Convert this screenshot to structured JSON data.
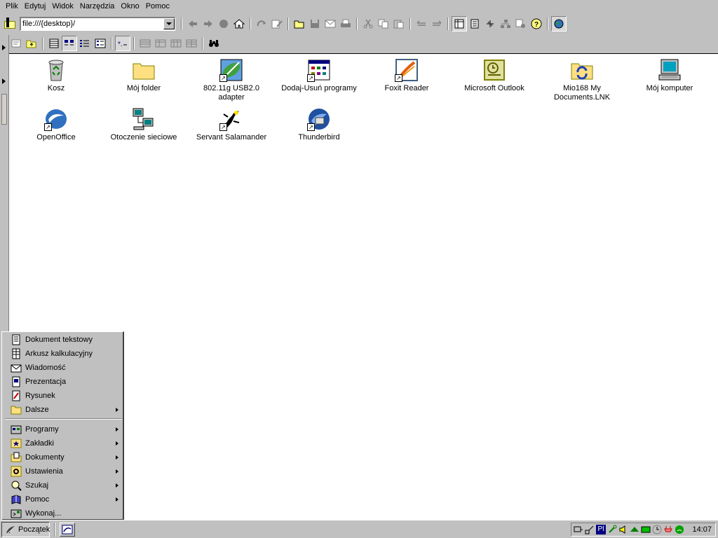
{
  "menubar": {
    "items": [
      {
        "label": "Plik"
      },
      {
        "label": "Edytuj"
      },
      {
        "label": "Widok"
      },
      {
        "label": "Narzędzia"
      },
      {
        "label": "Okno"
      },
      {
        "label": "Pomoc"
      }
    ]
  },
  "address": {
    "value": "file:///{desktop}/"
  },
  "toolbar1": {
    "icons": [
      "back-arrow-icon",
      "forward-arrow-icon",
      "stop-icon",
      "home-icon",
      "reload-icon",
      "edit-icon",
      "open-icon",
      "save-icon",
      "mail-icon",
      "print-icon",
      "cut-icon",
      "copy-icon",
      "paste-icon",
      "undo-icon",
      "redo-icon",
      "panel-icon",
      "bookmark-icon",
      "tools-icon",
      "hierarchy-icon",
      "settings-icon",
      "help-icon",
      "globe-icon"
    ]
  },
  "toolbar2": {
    "icons": [
      "properties-icon",
      "up-folder-icon",
      "details-view-icon",
      "icons-view-icon",
      "list-view-icon",
      "tree-view-icon",
      "filter-icon",
      "cols-icon",
      "cols2-icon",
      "cols3-icon",
      "cols4-icon",
      "binoculars-icon"
    ]
  },
  "desktop": {
    "icons": [
      {
        "label": "Kosz",
        "icon": "recycle-bin-icon",
        "shortcut": false
      },
      {
        "label": "Mój folder",
        "icon": "folder-icon",
        "shortcut": false
      },
      {
        "label": "802.11g USB2.0 adapter",
        "icon": "network-adapter-icon",
        "shortcut": true
      },
      {
        "label": "Dodaj-Usuń programy",
        "icon": "add-remove-programs-icon",
        "shortcut": true
      },
      {
        "label": "Foxit Reader",
        "icon": "foxit-icon",
        "shortcut": true
      },
      {
        "label": "Microsoft Outlook",
        "icon": "outlook-icon",
        "shortcut": false
      },
      {
        "label": "Mio168 My Documents.LNK",
        "icon": "sync-folder-icon",
        "shortcut": false
      },
      {
        "label": "Mój komputer",
        "icon": "computer-icon",
        "shortcut": false
      },
      {
        "label": "OpenOffice",
        "icon": "openoffice-icon",
        "shortcut": true
      },
      {
        "label": "Otoczenie sieciowe",
        "icon": "network-neighborhood-icon",
        "shortcut": false
      },
      {
        "label": "Servant Salamander",
        "icon": "salamander-icon",
        "shortcut": true
      },
      {
        "label": "Thunderbird",
        "icon": "thunderbird-icon",
        "shortcut": true
      }
    ]
  },
  "startmenu": {
    "items_top": [
      {
        "label": "Dokument tekstowy",
        "submenu": false
      },
      {
        "label": "Arkusz kalkulacyjny",
        "submenu": false
      },
      {
        "label": "Wiadomość",
        "submenu": false
      },
      {
        "label": "Prezentacja",
        "submenu": false
      },
      {
        "label": "Rysunek",
        "submenu": false
      },
      {
        "label": "Dalsze",
        "submenu": true
      }
    ],
    "items_bottom": [
      {
        "label": "Programy",
        "submenu": true
      },
      {
        "label": "Zakładki",
        "submenu": true
      },
      {
        "label": "Dokumenty",
        "submenu": true
      },
      {
        "label": "Ustawienia",
        "submenu": true
      },
      {
        "label": "Szukaj",
        "submenu": true
      },
      {
        "label": "Pomoc",
        "submenu": true
      },
      {
        "label": "Wykonaj...",
        "submenu": false
      }
    ]
  },
  "taskbar": {
    "start_label": "Początek",
    "tray_lang": "Pl",
    "clock": "14:07"
  },
  "colors": {
    "face": "#c0c0c0",
    "desktop": "#ffffff",
    "tray_lang_bg": "#000080"
  }
}
